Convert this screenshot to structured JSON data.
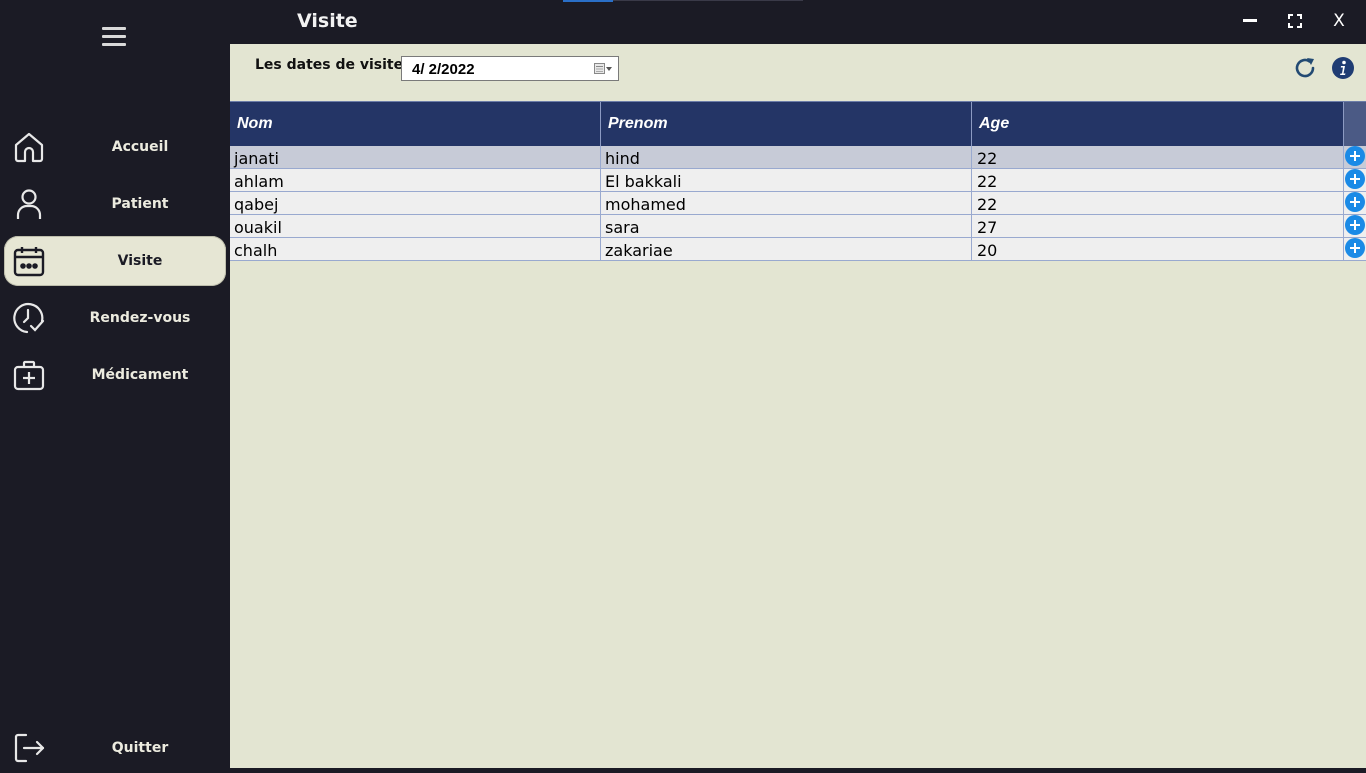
{
  "window": {
    "title": "Visite",
    "minimize_icon": "minimize-icon",
    "maximize_icon": "maximize-icon",
    "close_label": "X"
  },
  "sidebar": {
    "menu_icon": "hamburger-icon",
    "items": [
      {
        "label": "Accueil",
        "icon": "home-icon",
        "active": false
      },
      {
        "label": "Patient",
        "icon": "user-icon",
        "active": false
      },
      {
        "label": "Visite",
        "icon": "calendar-icon",
        "active": true
      },
      {
        "label": "Rendez-vous",
        "icon": "clock-check-icon",
        "active": false
      },
      {
        "label": "Médicament",
        "icon": "medical-kit-icon",
        "active": false
      }
    ],
    "quit": {
      "label": "Quitter",
      "icon": "logout-icon"
    }
  },
  "filter": {
    "label": "Les dates de visites",
    "date_value": "4/  2/2022"
  },
  "toolbar": {
    "refresh_icon": "refresh-icon",
    "info_icon": "info-icon"
  },
  "table": {
    "columns": [
      "Nom",
      "Prenom",
      "Age"
    ],
    "rows": [
      {
        "nom": "janati",
        "prenom": "hind",
        "age": "22",
        "selected": true
      },
      {
        "nom": "ahlam",
        "prenom": "El bakkali",
        "age": "22",
        "selected": false
      },
      {
        "nom": "qabej",
        "prenom": "mohamed",
        "age": "22",
        "selected": false
      },
      {
        "nom": "ouakil",
        "prenom": "sara",
        "age": "27",
        "selected": false
      },
      {
        "nom": "chalh",
        "prenom": "zakariae",
        "age": "20",
        "selected": false
      }
    ]
  },
  "colors": {
    "sidebar_bg": "#1b1b25",
    "main_bg": "#e3e5d2",
    "header_bg": "#243566",
    "add_button": "#1a8ae6",
    "active_item_bg": "#e6e6d4"
  }
}
